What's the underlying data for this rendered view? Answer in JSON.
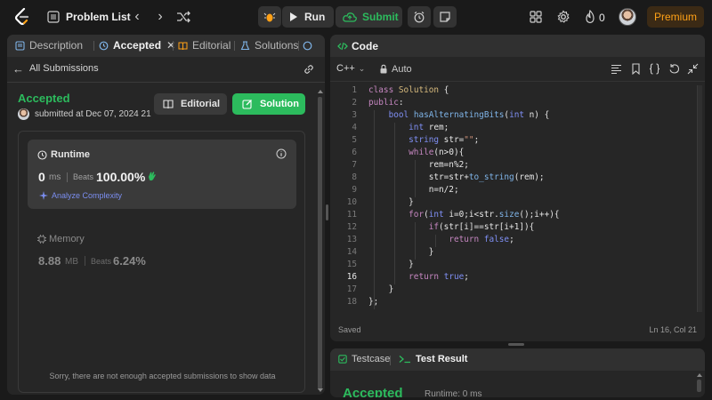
{
  "topbar": {
    "problem_list": "Problem List",
    "run_label": "Run",
    "submit_label": "Submit",
    "streak_count": "0",
    "premium_label": "Premium"
  },
  "left_tabs": {
    "description": "Description",
    "accepted": "Accepted",
    "editorial": "Editorial",
    "solutions": "Solutions"
  },
  "submission": {
    "back_label": "All Submissions",
    "status": "Accepted",
    "submitted_text": "submitted at Dec 07, 2024 21",
    "editorial_button": "Editorial",
    "solution_button": "Solution"
  },
  "runtime": {
    "title": "Runtime",
    "value": "0",
    "unit": "ms",
    "beats_label": "Beats",
    "beats_pct": "100.00%",
    "analyze_label": "Analyze Complexity"
  },
  "memory": {
    "title": "Memory",
    "value": "8.88",
    "unit": "MB",
    "beats_label": "Beats",
    "beats_pct": "6.24%"
  },
  "no_data_text": "Sorry, there are not enough accepted submissions to show data",
  "code_panel": {
    "title": "Code",
    "language": "C++",
    "mode": "Auto",
    "status": "Saved",
    "cursor": "Ln 16, Col 21",
    "current_line": 16,
    "lines": [
      "class Solution {",
      "public:",
      "    bool hasAlternatingBits(int n) {",
      "        int rem;",
      "        string str=\"\";",
      "        while(n>0){",
      "            rem=n%2;",
      "            str=str+to_string(rem);",
      "            n=n/2;",
      "        }",
      "        for(int i=0;i<str.size();i++){",
      "            if(str[i]==str[i+1]){",
      "                return false;",
      "            }",
      "        }",
      "        return true;",
      "    }",
      "};"
    ]
  },
  "test_panel": {
    "testcase_tab": "Testcase",
    "result_tab": "Test Result",
    "result_status": "Accepted",
    "result_runtime": "Runtime: 0 ms"
  },
  "colors": {
    "accent_green": "#2cbb5d",
    "premium_orange": "#ffa116",
    "link_blue": "#7b8ef0"
  }
}
